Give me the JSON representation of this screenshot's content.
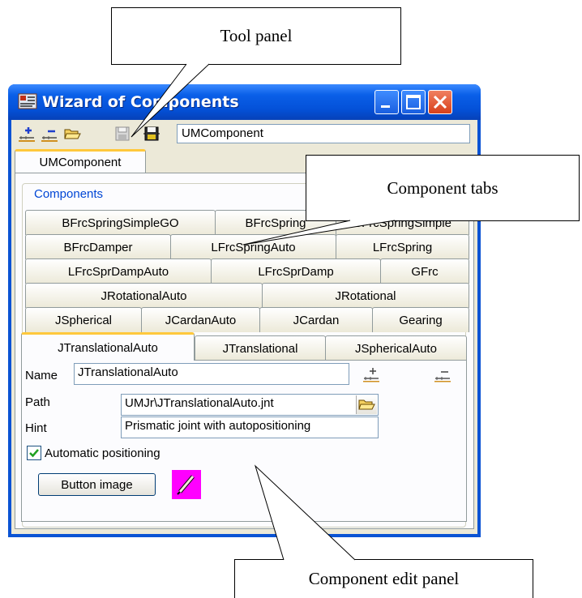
{
  "callouts": {
    "tool_panel": "Tool panel",
    "component_tabs": "Component tabs",
    "component_edit_panel": "Component edit panel"
  },
  "window": {
    "title": "Wizard of Components",
    "toolbar_icons": [
      "add-component-icon",
      "remove-component-icon",
      "open-folder-icon",
      "save-disabled-icon",
      "save-icon"
    ],
    "component_name": "UMComponent"
  },
  "outer_tab": "UMComponent",
  "group_label": "Components",
  "tab_rows": [
    [
      "BFrcSpringSimpleGO",
      "BFrcSpring",
      "BFrcSpringSimple"
    ],
    [
      "BFrcDamper",
      "LFrcSpringAuto",
      "LFrcSpring"
    ],
    [
      "LFrcSprDampAuto",
      "LFrcSprDamp",
      "GFrc"
    ],
    [
      "JRotationalAuto",
      "JRotational"
    ],
    [
      "JSpherical",
      "JCardanAuto",
      "JCardan",
      "Gearing"
    ],
    [
      "JTranslationalAuto",
      "JTranslational",
      "JSphericalAuto"
    ]
  ],
  "active_tab": "JTranslationalAuto",
  "edit": {
    "name_label": "Name",
    "name_value": "JTranslationalAuto",
    "path_label": "Path",
    "path_value": "UMJr\\JTranslationalAuto.jnt",
    "hint_label": "Hint",
    "hint_value": "Prismatic joint with autopositioning",
    "auto_label": "Automatic positioning",
    "auto_checked": true,
    "button_image_label": "Button image"
  },
  "colors": {
    "title_bar": "#0a5fe8",
    "tab_accent": "#ffc83c",
    "group_label": "#0046d5",
    "image_preview": "#ff00ff"
  }
}
